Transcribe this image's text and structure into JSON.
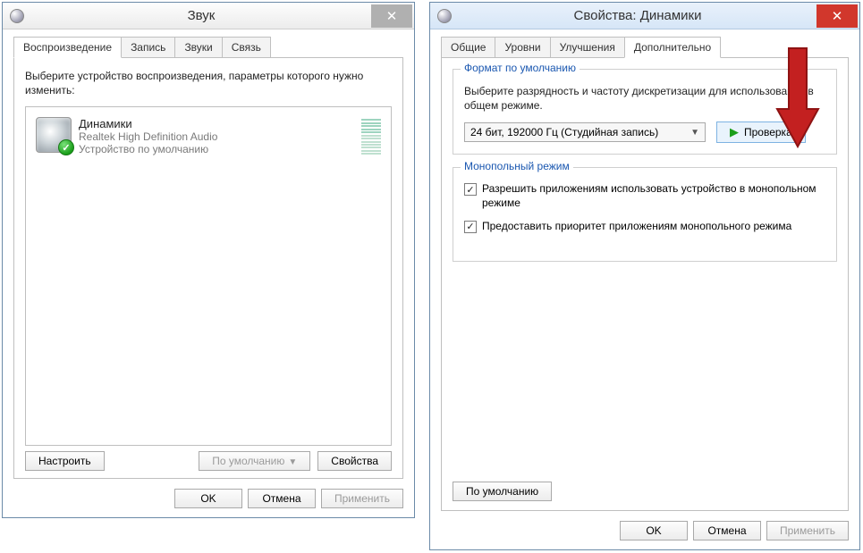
{
  "sound_dialog": {
    "title": "Звук",
    "tabs": [
      "Воспроизведение",
      "Запись",
      "Звуки",
      "Связь"
    ],
    "active_tab": 0,
    "instruction": "Выберите устройство воспроизведения, параметры которого нужно изменить:",
    "devices": [
      {
        "name": "Динамики",
        "subtitle": "Realtek High Definition Audio",
        "status": "Устройство по умолчанию"
      }
    ],
    "configure_label": "Настроить",
    "set_default_label": "По умолчанию",
    "properties_label": "Свойства",
    "ok": "OK",
    "cancel": "Отмена",
    "apply": "Применить"
  },
  "props_dialog": {
    "title": "Свойства: Динамики",
    "tabs": [
      "Общие",
      "Уровни",
      "Улучшения",
      "Дополнительно"
    ],
    "active_tab": 3,
    "default_format_legend": "Формат по умолчанию",
    "default_format_text": "Выберите разрядность и частоту дискретизации для использования в общем режиме.",
    "format_selected": "24 бит, 192000 Гц (Студийная запись)",
    "test_label": "Проверка",
    "exclusive_legend": "Монопольный режим",
    "exclusive_opt1": "Разрешить приложениям использовать устройство в монопольном режиме",
    "exclusive_opt2": "Предоставить приоритет приложениям монопольного режима",
    "restore_defaults": "По умолчанию",
    "ok": "OK",
    "cancel": "Отмена",
    "apply": "Применить"
  }
}
